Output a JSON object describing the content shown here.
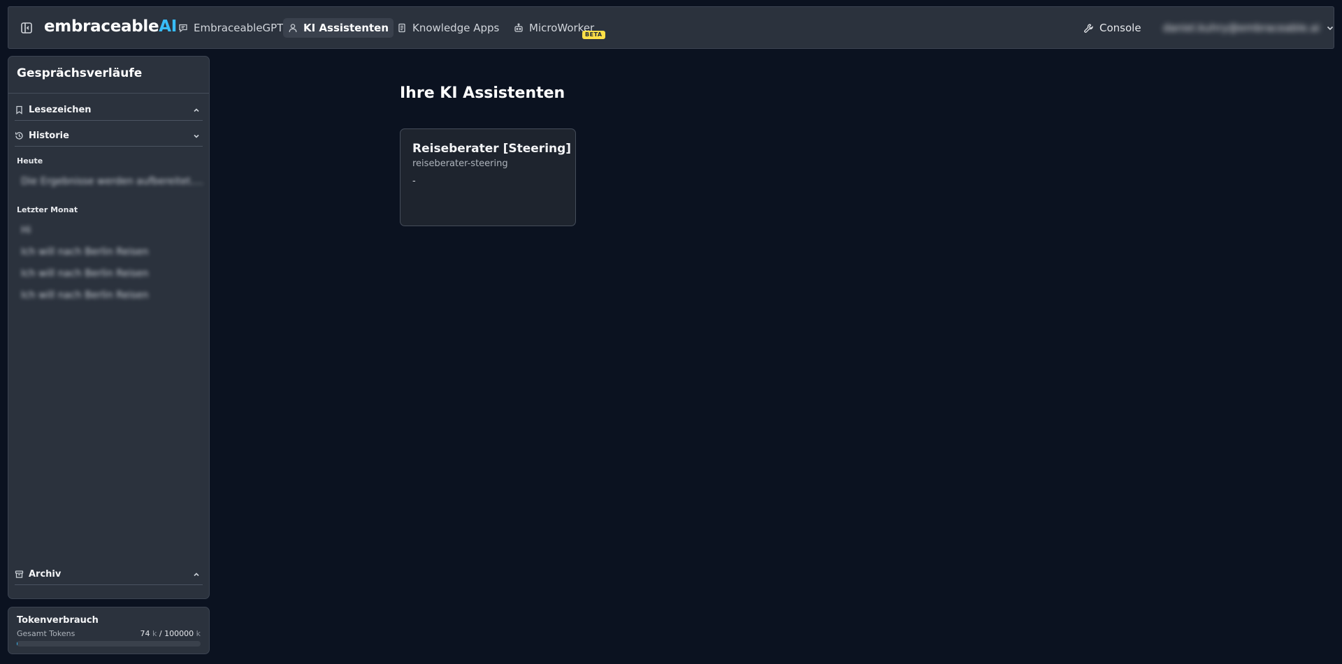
{
  "header": {
    "logo_main": "embraceable",
    "logo_accent": "AI",
    "nav": [
      {
        "label": "EmbraceableGPT",
        "icon": "chat-icon"
      },
      {
        "label": "KI Assistenten",
        "icon": "user-icon",
        "active": true
      },
      {
        "label": "Knowledge Apps",
        "icon": "document-icon"
      },
      {
        "label": "MicroWorker",
        "icon": "bot-icon",
        "badge": "BETA"
      }
    ],
    "console_label": "Console",
    "user_email": "daniel.kuhry@embraceable.ai"
  },
  "sidebar": {
    "title": "Gesprächsverläufe",
    "bookmarks": {
      "label": "Lesezeichen",
      "expanded": false
    },
    "history": {
      "label": "Historie",
      "expanded": true,
      "groups": [
        {
          "label": "Heute",
          "items": [
            "Die Ergebnisse werden aufbereitet. Bi..."
          ]
        },
        {
          "label": "Letzter Monat",
          "items": [
            "Hi",
            "Ich will nach Berlin Reisen",
            "Ich will nach Berlin Reisen",
            "Ich will nach Berlin Reisen"
          ]
        }
      ]
    },
    "archive": {
      "label": "Archiv",
      "expanded": false
    }
  },
  "tokens": {
    "title": "Tokenverbrauch",
    "label": "Gesamt Tokens",
    "used": "74",
    "limit": "100000",
    "unit": "k",
    "fraction": 0.00074
  },
  "main": {
    "title": "Ihre KI Assistenten",
    "cards": [
      {
        "title": "Reiseberater [Steering]",
        "slug": "reiseberater-steering",
        "description": "-"
      }
    ]
  },
  "colors": {
    "background": "#0b1220",
    "panel": "#2b323d",
    "accent": "#38bdf8",
    "beta_badge": "#fde047"
  }
}
